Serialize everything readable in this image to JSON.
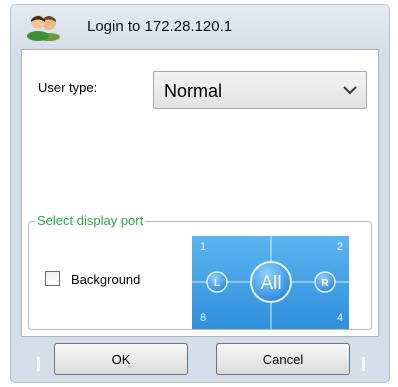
{
  "window": {
    "title": "Login to 172.28.120.1",
    "title_icon": "users-icon"
  },
  "user_type": {
    "label": "User type:",
    "selected": "Normal"
  },
  "display_port": {
    "group_label": "Select display port",
    "background_label": "Background",
    "background_checked": false,
    "ports": {
      "top_left": "1",
      "top_right": "2",
      "bottom_left": "8",
      "bottom_right": "4",
      "center": "All",
      "left": "L",
      "right": "R"
    }
  },
  "buttons": {
    "ok": "OK",
    "cancel": "Cancel"
  },
  "colors": {
    "accent_green": "#2aa84a",
    "port_blue": "#2f8fdc"
  }
}
